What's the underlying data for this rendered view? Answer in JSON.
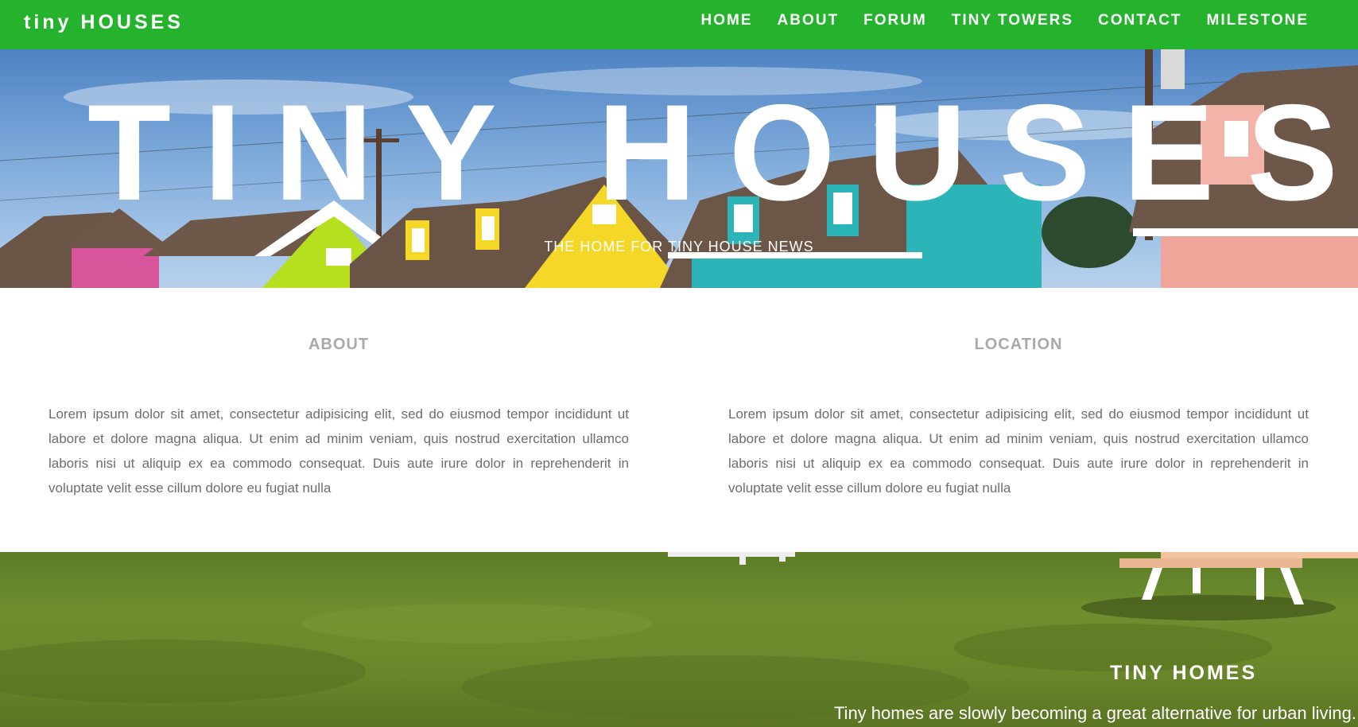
{
  "nav": {
    "brand": "tiny HOUSES",
    "links": [
      "HOME",
      "ABOUT",
      "FORUM",
      "TINY TOWERS",
      "CONTACT",
      "MILESTONE"
    ]
  },
  "hero": {
    "title": "TINY HOUSES",
    "subtitle": "THE HOME FOR TINY HOUSE NEWS"
  },
  "sections": {
    "about": {
      "heading": "ABOUT",
      "body": "Lorem ipsum dolor sit amet, consectetur adipisicing elit, sed do eiusmod tempor incididunt ut labore et dolore magna aliqua. Ut enim ad minim veniam, quis nostrud exercitation ullamco laboris nisi ut aliquip ex ea commodo consequat. Duis aute irure dolor in reprehenderit in voluptate velit esse cillum dolore eu fugiat nulla"
    },
    "location": {
      "heading": "LOCATION",
      "body": "Lorem ipsum dolor sit amet, consectetur adipisicing elit, sed do eiusmod tempor incididunt ut labore et dolore magna aliqua. Ut enim ad minim veniam, quis nostrud exercitation ullamco laboris nisi ut aliquip ex ea commodo consequat. Duis aute irure dolor in reprehenderit in voluptate velit esse cillum dolore eu fugiat nulla"
    }
  },
  "feature": {
    "title": "TINY HOMES",
    "text": "Tiny homes are slowly becoming a great alternative for urban living."
  },
  "colors": {
    "navbar": "#25b22c",
    "heading": "#a9a9a9",
    "body_text": "#6d6d6d"
  }
}
